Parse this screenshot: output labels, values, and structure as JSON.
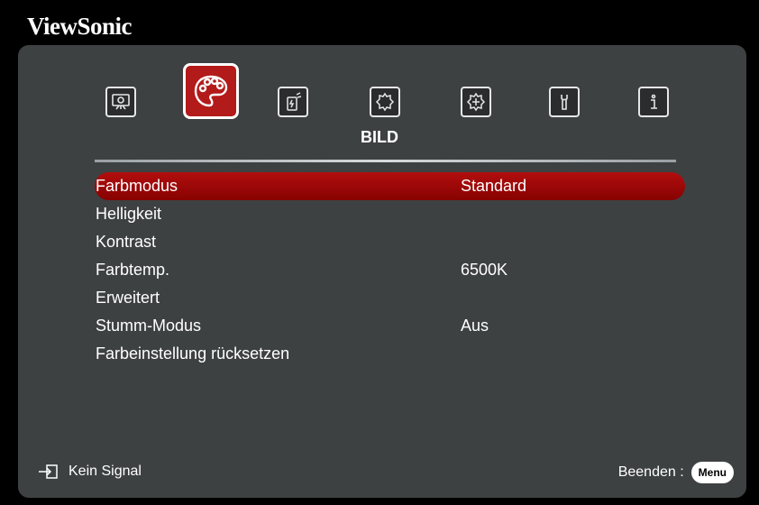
{
  "brand": "ViewSonic",
  "tabs": [
    {
      "name": "display",
      "icon": "display-icon"
    },
    {
      "name": "picture",
      "icon": "palette-icon",
      "active": true
    },
    {
      "name": "power",
      "icon": "power-management-icon"
    },
    {
      "name": "basic",
      "icon": "basic-settings-icon"
    },
    {
      "name": "advanced",
      "icon": "advanced-settings-icon"
    },
    {
      "name": "system",
      "icon": "wrench-icon"
    },
    {
      "name": "info",
      "icon": "info-icon"
    }
  ],
  "active_tab_title": "BILD",
  "menu": {
    "items": [
      {
        "label": "Farbmodus",
        "value": "Standard"
      },
      {
        "label": "Helligkeit",
        "value": ""
      },
      {
        "label": "Kontrast",
        "value": ""
      },
      {
        "label": "Farbtemp.",
        "value": "6500K"
      },
      {
        "label": "Erweitert",
        "value": ""
      },
      {
        "label": "Stumm-Modus",
        "value": "Aus"
      },
      {
        "label": "Farbeinstellung rücksetzen",
        "value": ""
      }
    ]
  },
  "footer": {
    "signal_text": "Kein Signal",
    "exit_label": "Beenden :",
    "menu_button": "Menu"
  },
  "colors": {
    "highlight": "#a30a0a",
    "panel": "#3e4142",
    "active_tab": "#b31a1a"
  }
}
